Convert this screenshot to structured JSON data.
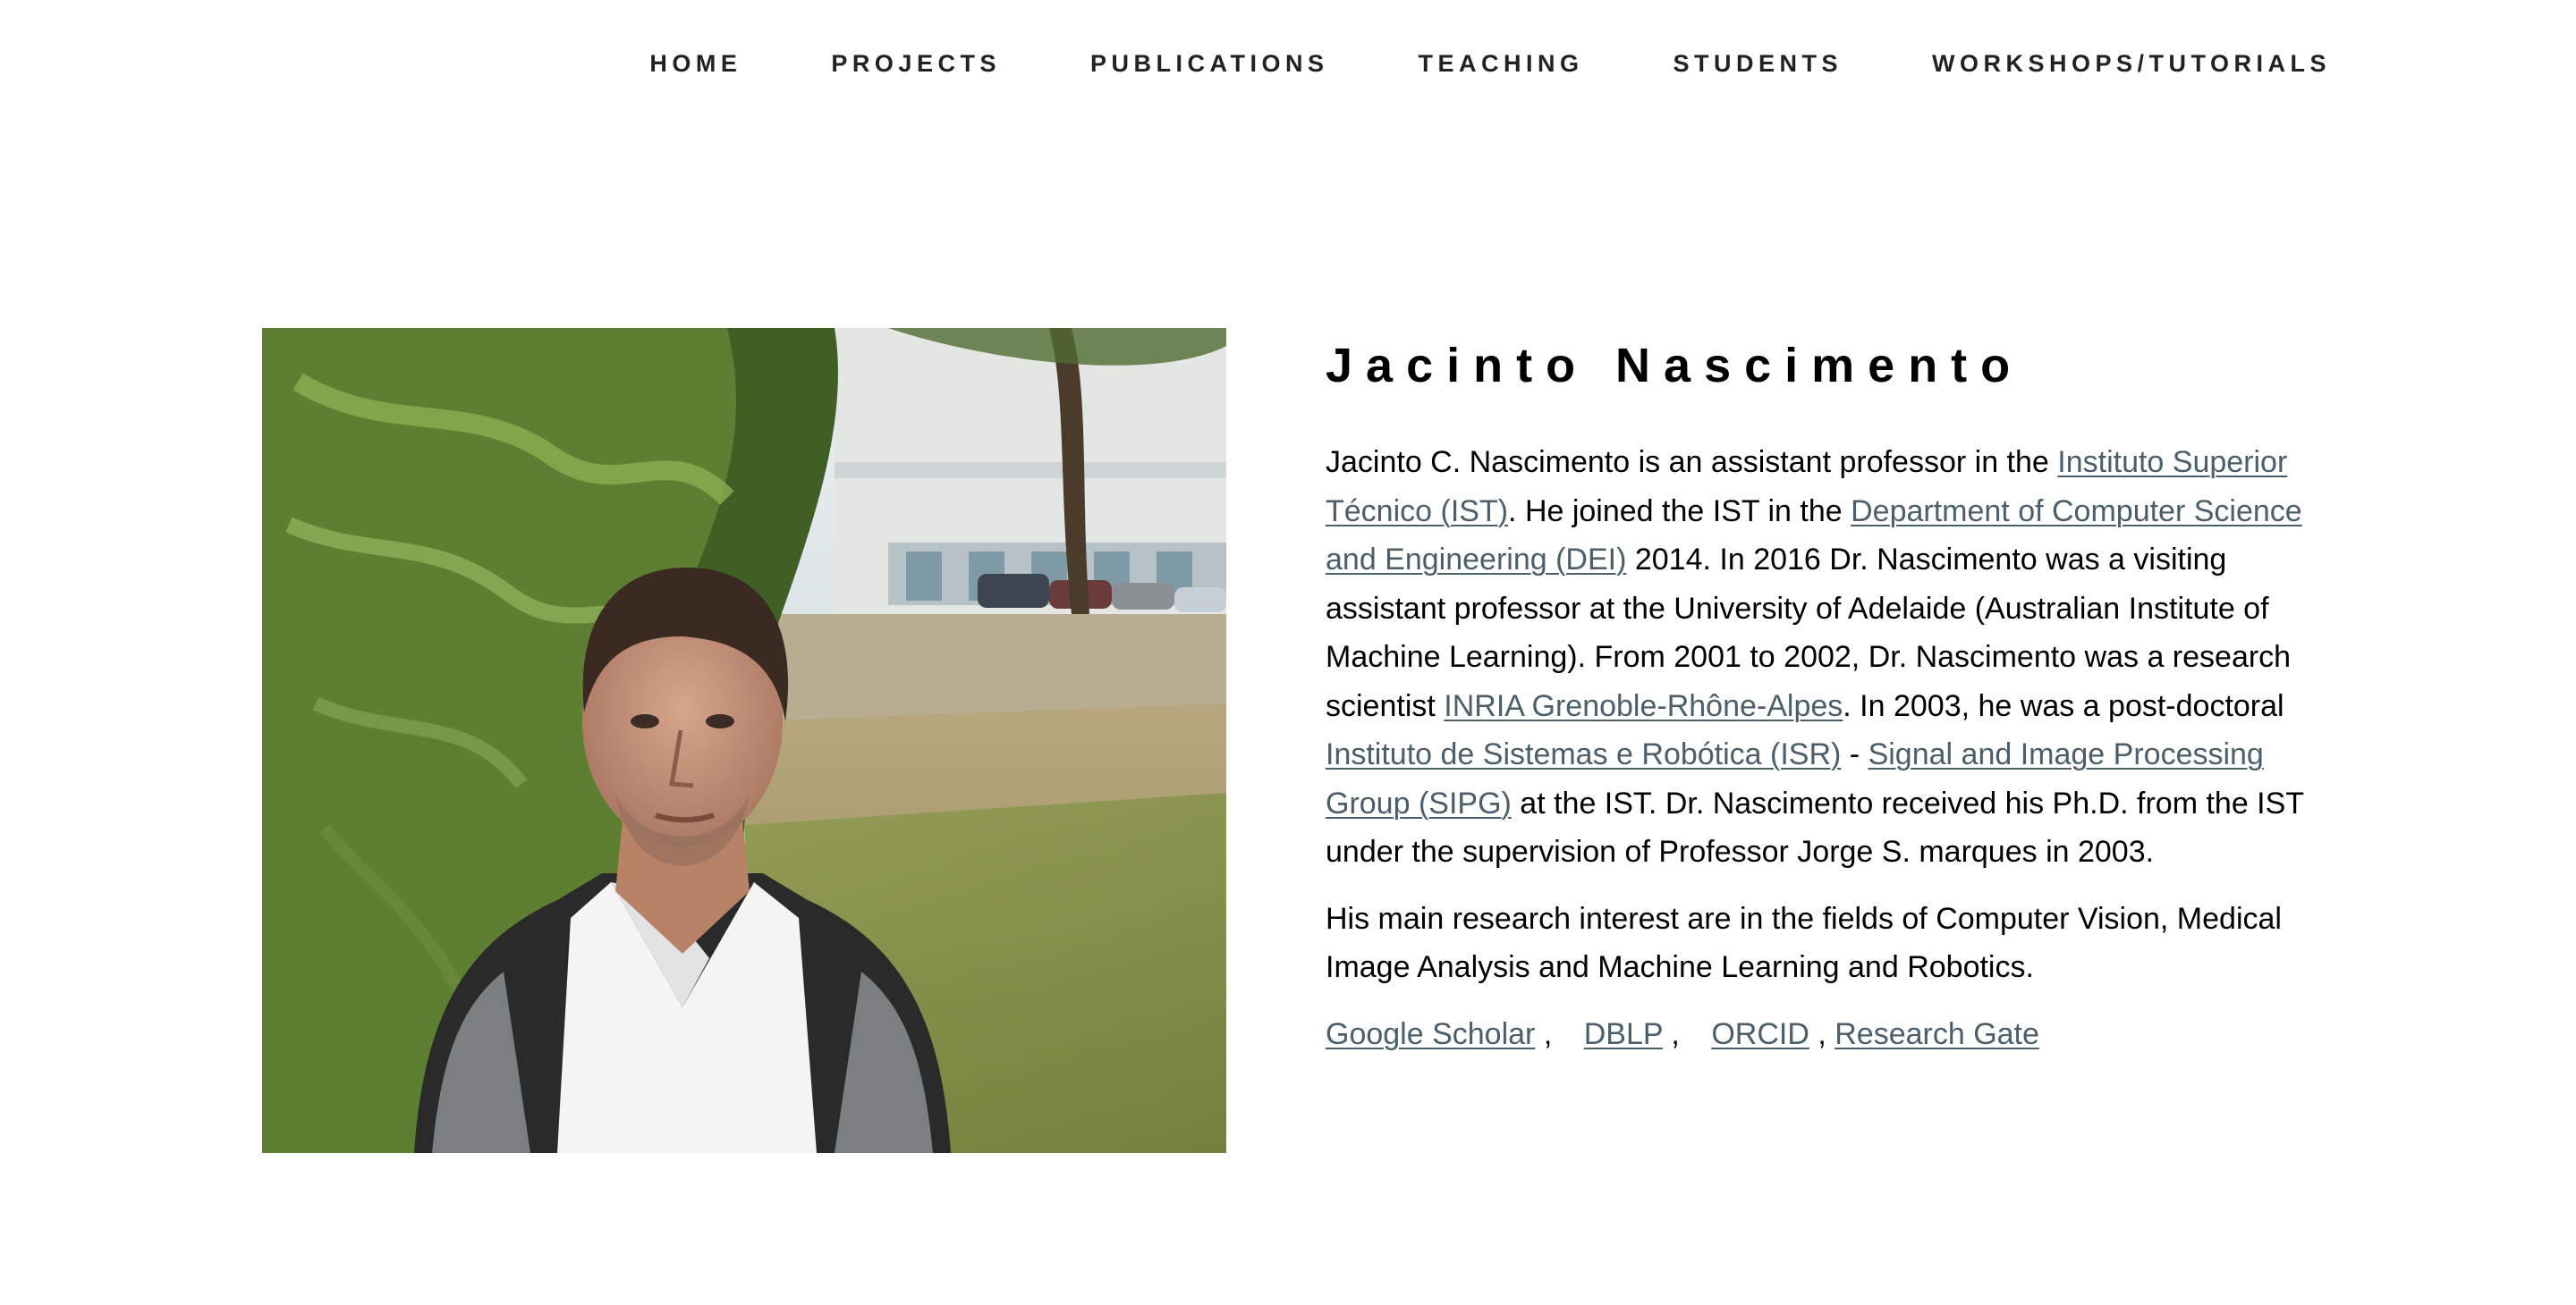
{
  "nav": {
    "items": [
      {
        "label": "HOME"
      },
      {
        "label": "PROJECTS"
      },
      {
        "label": "PUBLICATIONS"
      },
      {
        "label": "TEACHING"
      },
      {
        "label": "STUDENTS"
      },
      {
        "label": "WORKSHOPS/TUTORIALS"
      }
    ]
  },
  "profile": {
    "name": "Jacinto Nascimento",
    "bio": {
      "t1": "Jacinto C. Nascimento is an assistant professor in the ",
      "link_ist": "Instituto Superior Técnico (IST)",
      "t2": ". He joined the IST in the ",
      "link_dei": "Department of Computer Science and Engineering (DEI)",
      "t3": " 2014. In 2016 Dr. Nascimento was a visiting assistant professor at the University of Adelaide (Australian Institute of Machine Learning). From 2001 to 2002, Dr. Nascimento was a research scientist ",
      "link_inria": "INRIA Grenoble-Rhône-Alpes",
      "t4": ". In 2003, he was a post-doctoral ",
      "link_isr": "Instituto de Sistemas e Robótica (ISR)",
      "t5": " - ",
      "link_sipg": "Signal and Image Processing Group (SIPG)",
      "t6": " at the IST. Dr. Nascimento received his Ph.D. from the IST under the supervision of Professor Jorge S. marques in 2003."
    },
    "research": "His main research interest are in the fields of Computer Vision, Medical Image Analysis and Machine Learning and Robotics.",
    "profile_links": {
      "scholar": "Google Scholar",
      "dblp": "DBLP",
      "orcid": "ORCID",
      "researchgate": "Research Gate",
      "separator": ","
    }
  },
  "colors": {
    "link": "#4b5e6a",
    "nav_text": "#222222",
    "text": "#000000",
    "background": "#ffffff"
  }
}
